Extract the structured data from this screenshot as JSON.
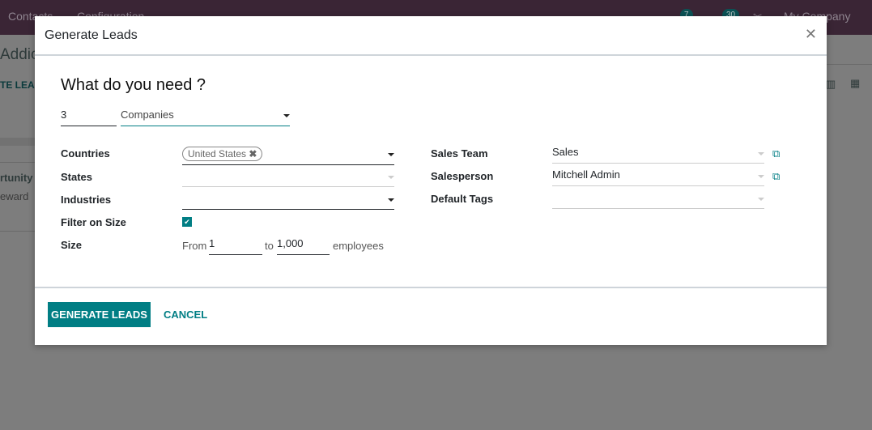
{
  "topbar": {
    "menu": [
      "Contacts",
      "Configuration"
    ],
    "messages_count": "7",
    "activities_count": "30",
    "company": "My Company"
  },
  "background": {
    "title": "Addic",
    "button": "TE LEAD",
    "card_title": "rtunity",
    "card_sub": "eward"
  },
  "dialog": {
    "title": "Generate Leads",
    "heading": "What do you need ?",
    "count": "3",
    "target_type": "Companies",
    "countries_label": "Countries",
    "countries_tags": [
      "United States"
    ],
    "states_label": "States",
    "states_value": "",
    "industries_label": "Industries",
    "industries_value": "",
    "filter_size_label": "Filter on Size",
    "filter_size_checked": true,
    "size_label": "Size",
    "size_from_text": "From",
    "size_from": "1",
    "size_to_text": "to",
    "size_to": "1,000",
    "size_unit": "employees",
    "sales_team_label": "Sales Team",
    "sales_team": "Sales",
    "salesperson_label": "Salesperson",
    "salesperson": "Mitchell Admin",
    "default_tags_label": "Default Tags",
    "default_tags": "",
    "generate_button": "GENERATE LEADS",
    "cancel_button": "CANCEL"
  },
  "colors": {
    "primary": "#017e84",
    "topbar": "#3a2535"
  }
}
